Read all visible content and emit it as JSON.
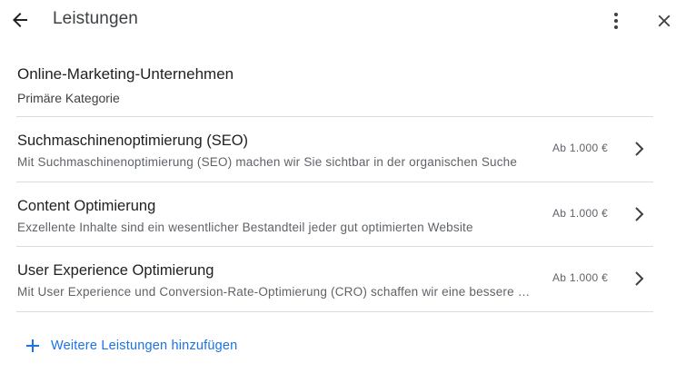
{
  "header": {
    "title": "Leistungen",
    "back_icon": "arrow-back-icon",
    "more_icon": "more-vert-icon",
    "close_icon": "close-icon"
  },
  "category": {
    "name": "Online-Marketing-Unternehmen",
    "label": "Primäre Kategorie"
  },
  "services": [
    {
      "name": "Suchmaschinenoptimierung (SEO)",
      "description": "Mit Suchmaschinenoptimierung (SEO) machen wir Sie sichtbar in der organischen Suche",
      "price": "Ab 1.000 €"
    },
    {
      "name": "Content Optimierung",
      "description": "Exzellente Inhalte sind ein wesentlicher Bestandteil jeder gut optimierten Website",
      "price": "Ab 1.000 €"
    },
    {
      "name": "User Experience Optimierung",
      "description": "Mit User Experience und Conversion-Rate-Optimierung (CRO) schaffen wir eine bessere Nutzererfahrung",
      "price": "Ab 1.000 €"
    }
  ],
  "actions": {
    "add_label": "Weitere Leistungen hinzufügen",
    "add_icon": "plus-icon"
  },
  "colors": {
    "accent": "#1a73e8",
    "divider": "#dadce0",
    "text_primary": "#202124",
    "text_secondary": "#5f6368"
  }
}
